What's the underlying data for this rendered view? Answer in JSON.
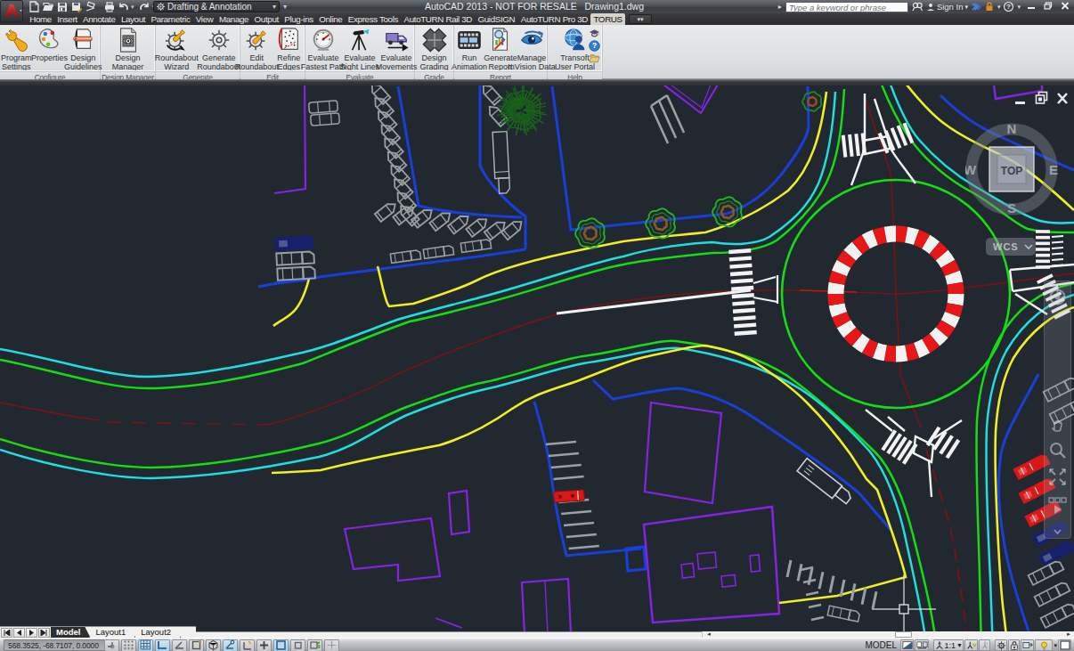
{
  "title_bar": {
    "app_title": "AutoCAD 2013 - NOT FOR RESALE",
    "document_name": "Drawing1.dwg",
    "workspace": "Drafting & Annotation",
    "search_placeholder": "Type a keyword or phrase",
    "sign_in": "Sign In"
  },
  "menu_tabs": [
    "Home",
    "Insert",
    "Annotate",
    "Layout",
    "Parametric",
    "View",
    "Manage",
    "Output",
    "Plug-ins",
    "Online",
    "Express Tools",
    "AutoTURN Rail 3D",
    "GuidSIGN",
    "AutoTURN Pro 3D",
    "TORUS"
  ],
  "active_tab": "TORUS",
  "ribbon": {
    "panels": [
      {
        "title": "Configure",
        "width": 113,
        "buttons": [
          {
            "label": "Program\nSettings",
            "icon": "wrench"
          },
          {
            "label": "Properties",
            "icon": "palette"
          },
          {
            "label": "Design\nGuidelines",
            "icon": "guidelines"
          }
        ]
      },
      {
        "title": "Design Manager",
        "width": 62,
        "buttons": [
          {
            "label": "Design\nManager",
            "icon": "manager"
          }
        ]
      },
      {
        "title": "Generate",
        "width": 95,
        "buttons": [
          {
            "label": "Roundabout\nWizard",
            "icon": "wizard"
          },
          {
            "label": "Generate\nRoundabout",
            "icon": "gear"
          }
        ]
      },
      {
        "title": "Edit",
        "width": 73,
        "buttons": [
          {
            "label": "Edit\nRoundabout",
            "icon": "editgear"
          },
          {
            "label": "Refine\nEdges",
            "icon": "refine"
          }
        ]
      },
      {
        "title": "Evaluate",
        "width": 123,
        "buttons": [
          {
            "label": "Evaluate\nFastest Path",
            "icon": "gauge"
          },
          {
            "label": "Evaluate\nSight Lines",
            "icon": "tripod"
          },
          {
            "label": "Evaluate\nMovements",
            "icon": "truck"
          }
        ]
      },
      {
        "title": "Grade",
        "width": 44,
        "buttons": [
          {
            "label": "Design\nGrading",
            "icon": "cross"
          }
        ]
      },
      {
        "title": "Report",
        "width": 105,
        "buttons": [
          {
            "label": "Run\nAnimation",
            "icon": "film"
          },
          {
            "label": "Generate\nReport",
            "icon": "report"
          },
          {
            "label": "Manage\nInVision Data",
            "icon": "eye"
          }
        ]
      },
      {
        "title": "Help",
        "width": 62,
        "buttons": [
          {
            "label": "Transoft\nUser Portal",
            "icon": "portal"
          }
        ]
      }
    ]
  },
  "viewcube": {
    "north": "N",
    "south": "S",
    "east": "E",
    "west": "W",
    "face": "TOP",
    "ucs": "WCS"
  },
  "layout_tabs": [
    "Model",
    "Layout1",
    "Layout2"
  ],
  "active_layout_tab": "Model",
  "status_bar": {
    "coordinates": "568.3525,  -68.7107,  0.0000",
    "mode_label": "MODEL",
    "annotation_scale": "1:1"
  }
}
